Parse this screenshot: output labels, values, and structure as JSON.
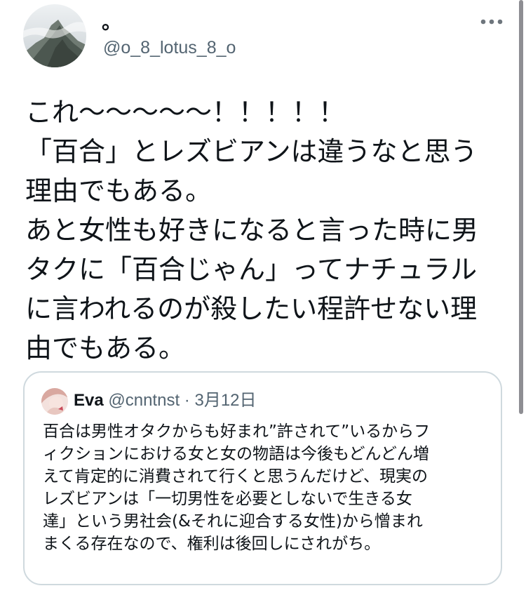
{
  "author": {
    "display_name": "。",
    "handle": "@o_8_lotus_8_o",
    "avatar_icon": "mountain-avatar-icon"
  },
  "more_icon": "more-horizontal-icon",
  "tweet": {
    "lines": [
      "これ〜〜〜〜〜！！！！！",
      "「百合」とレズビアンは違うなと思う",
      "理由でもある。",
      "あと女性も好きになると言った時に男",
      "タクに「百合じゃん」ってナチュラル",
      "に言われるのが殺したい程許せない理",
      "由でもある。"
    ]
  },
  "quote": {
    "name": "Eva",
    "handle": "@cnntnst",
    "separator": "·",
    "date": "3月12日",
    "avatar_icon": "user-avatar-icon",
    "lines": [
      "百合は男性オタクからも好まれ”許されて”いるからフ",
      "ィクションにおける女と女の物語は今後もどんどん増",
      "えて肯定的に消費されて行くと思うんだけど、現実の",
      "レズビアンは「一切男性を必要としないで生きる女",
      "達」という男社会(&それに迎合する女性)から憎まれ",
      "まくる存在なので、権利は後回しにされがち。"
    ]
  },
  "colors": {
    "text_primary": "#0f1419",
    "text_secondary": "#536471",
    "border": "#cfd9de",
    "scrollbar": "#8e8e93"
  }
}
